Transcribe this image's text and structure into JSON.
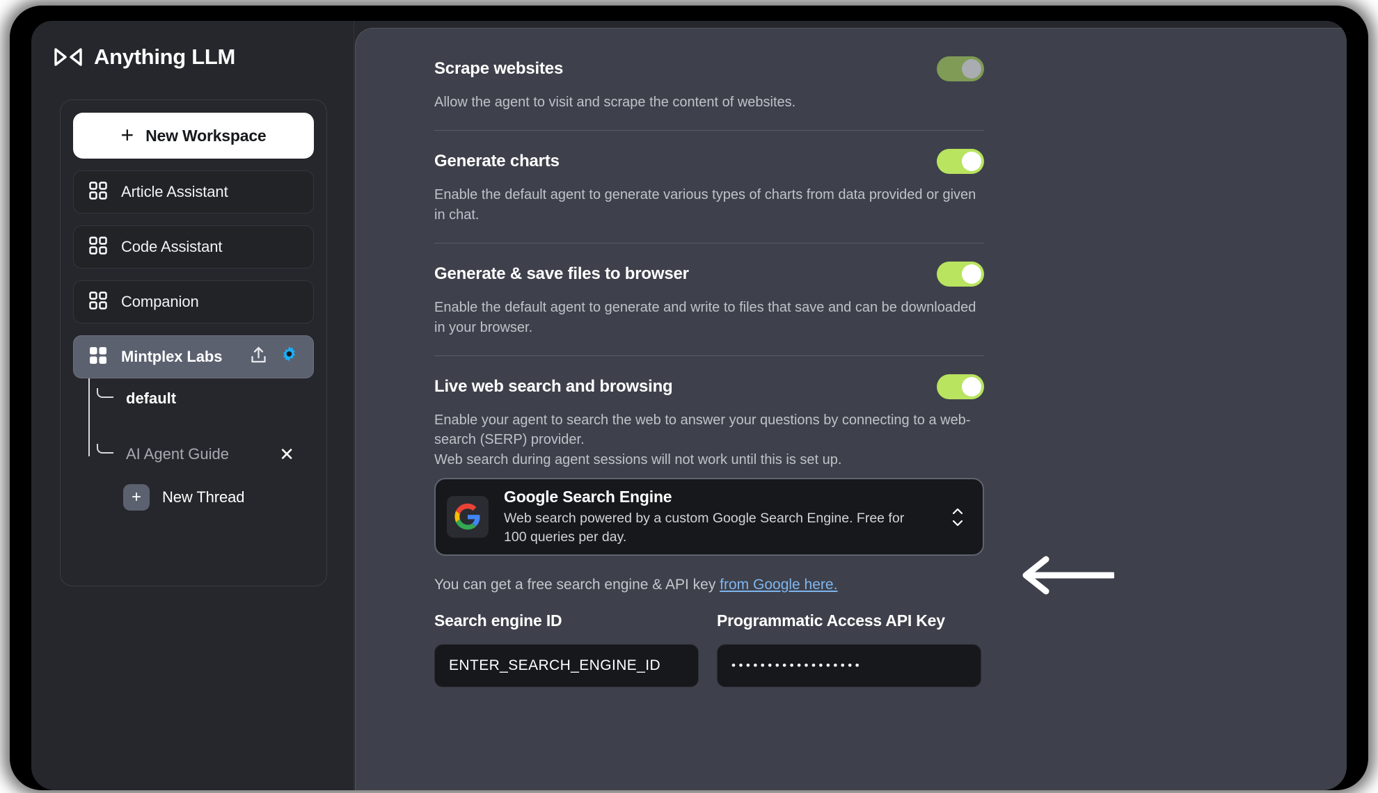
{
  "app": {
    "brand_title": "Anything LLM",
    "logo_icon": "anythingllm-logo-icon"
  },
  "sidebar": {
    "new_workspace": {
      "label": "New Workspace",
      "plus_icon": "plus-icon"
    },
    "workspaces": [
      {
        "label": "Article Assistant",
        "icon": "squares-four-icon",
        "selected": false
      },
      {
        "label": "Code Assistant",
        "icon": "squares-four-icon",
        "selected": false
      },
      {
        "label": "Companion",
        "icon": "squares-four-icon",
        "selected": false
      },
      {
        "label": "Mintplex Labs",
        "icon": "squares-four-filled-icon",
        "selected": true
      }
    ],
    "selected_workspace_actions": {
      "upload_icon": "upload-icon",
      "settings_icon": "gear-icon",
      "settings_icon_color": "#1badf4"
    },
    "threads": [
      {
        "label": "default",
        "active": true,
        "closable": false
      },
      {
        "label": "AI Agent Guide",
        "active": false,
        "closable": true,
        "close_icon": "close-icon"
      }
    ],
    "new_thread": {
      "label": "New Thread",
      "plus_icon": "plus-icon"
    }
  },
  "main": {
    "settings": [
      {
        "title": "Scrape websites",
        "description": "Allow the agent to visit and scrape the content of websites.",
        "toggle": {
          "state": "on",
          "style": "muted",
          "track_color": "#7f9b55",
          "knob_color": "#a9acb0"
        }
      },
      {
        "title": "Generate charts",
        "description": "Enable the default agent to generate various types of charts from data provided or given in chat.",
        "toggle": {
          "state": "on",
          "style": "bright",
          "track_color": "#b9e45f",
          "knob_color": "#ffffff"
        }
      },
      {
        "title": "Generate & save files to browser",
        "description": "Enable the default agent to generate and write to files that save and can be downloaded in your browser.",
        "toggle": {
          "state": "on",
          "style": "bright",
          "track_color": "#b9e45f",
          "knob_color": "#ffffff"
        }
      },
      {
        "title": "Live web search and browsing",
        "description": "Enable your agent to search the web to answer your questions by connecting to a web-search (SERP) provider.\nWeb search during agent sessions will not work until this is set up.",
        "toggle": {
          "state": "on",
          "style": "bright",
          "track_color": "#b9e45f",
          "knob_color": "#ffffff"
        }
      }
    ],
    "provider_select": {
      "name": "Google Search Engine",
      "description": "Web search powered by a custom Google Search Engine. Free for 100 queries per day.",
      "logo_icon": "google-logo-icon",
      "chevron_icon": "chevron-up-down-icon"
    },
    "helper": {
      "text_before": "You can get a free search engine & API key ",
      "link_text": "from Google here.",
      "link_color": "#7fb5f0"
    },
    "credentials": [
      {
        "label": "Search engine ID",
        "value": "ENTER_SEARCH_ENGINE_ID",
        "masked": false
      },
      {
        "label": "Programmatic Access API Key",
        "value": "••••••••••••••••••",
        "masked": true
      }
    ]
  },
  "annotation": {
    "arrow_icon": "arrow-left-icon",
    "color": "#ffffff"
  }
}
